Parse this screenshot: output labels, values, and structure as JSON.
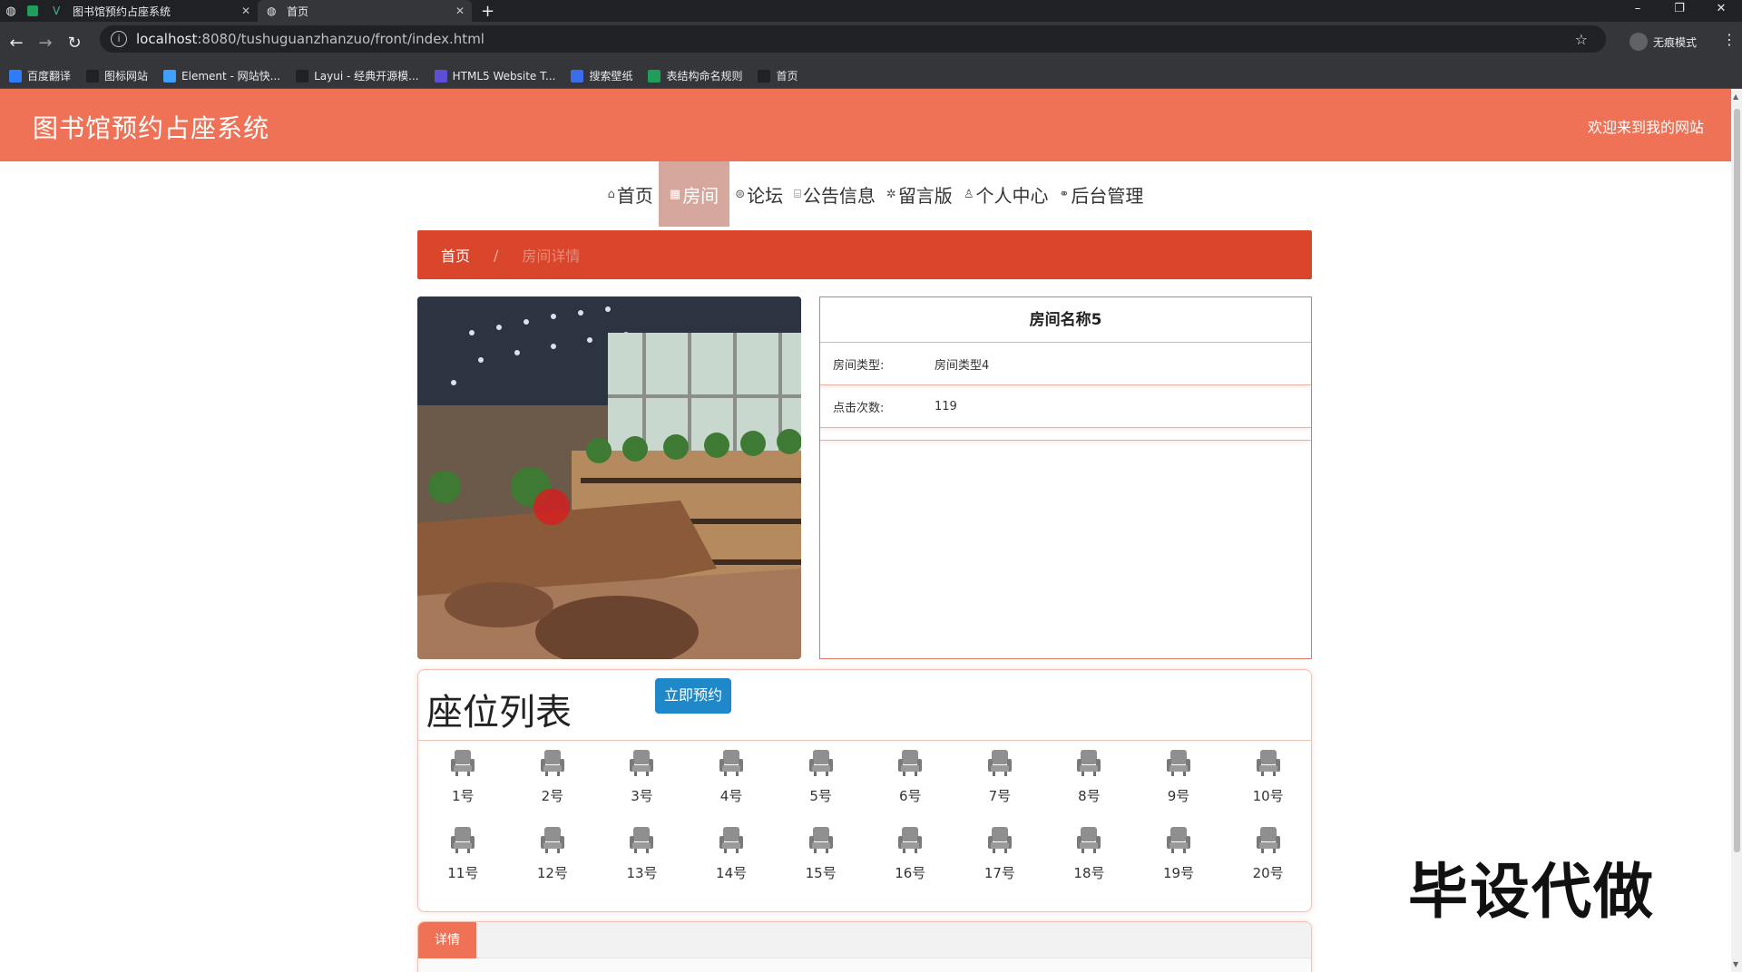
{
  "browser": {
    "tabs": [
      {
        "label": "图书馆预约占座系统"
      },
      {
        "label": "首页"
      }
    ],
    "url_host": "localhost",
    "url_rest": ":8080/tushuguanzhanzuo/front/index.html",
    "incognito_label": "无痕模式",
    "bookmarks": [
      {
        "label": "百度翻译",
        "icon": "baidu-translate-icon",
        "color": "#2e7cf6"
      },
      {
        "label": "图标网站",
        "icon": "flag-icon",
        "color": "#202124"
      },
      {
        "label": "Element - 网站快...",
        "icon": "element-icon",
        "color": "#409eff"
      },
      {
        "label": "Layui - 经典开源模...",
        "icon": "layui-icon",
        "color": "#202124"
      },
      {
        "label": "HTML5 Website T...",
        "icon": "html5-icon",
        "color": "#5c4fd6"
      },
      {
        "label": "搜索壁纸",
        "icon": "wallpaper-icon",
        "color": "#3a6ee8"
      },
      {
        "label": "表结构命名规则",
        "icon": "sheet-icon",
        "color": "#1e9e5a"
      },
      {
        "label": "首页",
        "icon": "globe-icon",
        "color": "#202124"
      }
    ]
  },
  "header": {
    "title": "图书馆预约占座系统",
    "welcome": "欢迎来到我的网站",
    "color": "#ef7257"
  },
  "nav": {
    "items": [
      {
        "label": "首页",
        "icon": "home-icon"
      },
      {
        "label": "房间",
        "icon": "room-icon",
        "active": true
      },
      {
        "label": "论坛",
        "icon": "forum-icon"
      },
      {
        "label": "公告信息",
        "icon": "notice-icon"
      },
      {
        "label": "留言版",
        "icon": "message-icon"
      },
      {
        "label": "个人中心",
        "icon": "user-icon"
      },
      {
        "label": "后台管理",
        "icon": "link-icon"
      }
    ]
  },
  "breadcrumb": {
    "home": "首页",
    "separator": "/",
    "current": "房间详情"
  },
  "room": {
    "name": "房间名称5",
    "type_label": "房间类型:",
    "type_value": "房间类型4",
    "clicks_label": "点击次数:",
    "clicks_value": "119"
  },
  "seats": {
    "title": "座位列表",
    "reserve_label": "立即预约",
    "list": [
      "1号",
      "2号",
      "3号",
      "4号",
      "5号",
      "6号",
      "7号",
      "8号",
      "9号",
      "10号",
      "11号",
      "12号",
      "13号",
      "14号",
      "15号",
      "16号",
      "17号",
      "18号",
      "19号",
      "20号"
    ]
  },
  "detail": {
    "tab_label": "详情"
  },
  "watermark": "毕设代做"
}
